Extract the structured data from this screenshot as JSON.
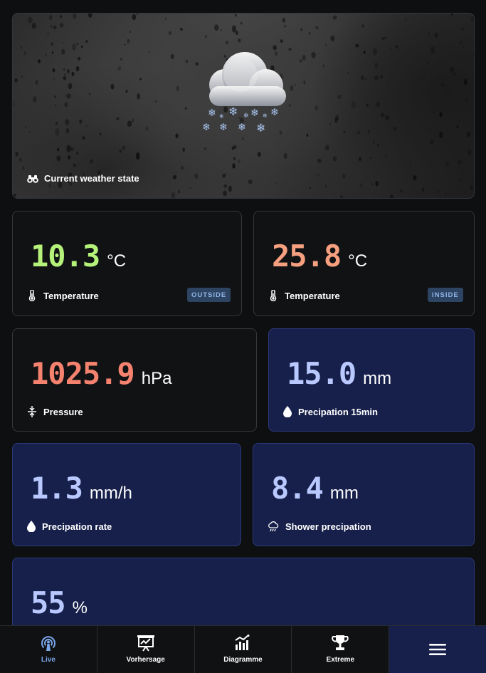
{
  "hero": {
    "label": "Current weather state",
    "state_icon": "snow-cloud-icon"
  },
  "tiles": {
    "temp_outside": {
      "value": "10.3",
      "unit": "°C",
      "label": "Temperature",
      "badge": "OUTSIDE",
      "icon": "thermometer-icon",
      "value_color": "#b5f27a"
    },
    "temp_inside": {
      "value": "25.8",
      "unit": "°C",
      "label": "Temperature",
      "badge": "INSIDE",
      "icon": "thermometer-icon",
      "value_color": "#f6a07f"
    },
    "pressure": {
      "value": "1025.9",
      "unit": "hPa",
      "label": "Pressure",
      "icon": "compress-arrows-icon",
      "value_color": "#f5826f"
    },
    "precip_15min": {
      "value": "15.0",
      "unit": "mm",
      "label": "Precipation 15min",
      "icon": "droplet-icon",
      "value_color": "#b9c9ff"
    },
    "precip_rate": {
      "value": "1.3",
      "unit": "mm/h",
      "label": "Precipation rate",
      "icon": "droplet-icon",
      "value_color": "#b9c9ff"
    },
    "shower_precip": {
      "value": "8.4",
      "unit": "mm",
      "label": "Shower precipation",
      "icon": "cloud-rain-icon",
      "value_color": "#b9c9ff"
    },
    "humidity": {
      "value": "55",
      "unit": "%",
      "value_color": "#b9c9ff"
    }
  },
  "nav": {
    "items": [
      {
        "label": "Live",
        "icon": "broadcast-icon",
        "active": true
      },
      {
        "label": "Vorhersage",
        "icon": "presentation-chart-icon"
      },
      {
        "label": "Diagramme",
        "icon": "bar-chart-icon"
      },
      {
        "label": "Extreme",
        "icon": "trophy-icon"
      }
    ],
    "menu_icon": "hamburger-menu-icon"
  },
  "colors": {
    "accent": "#7aa7ea",
    "card_blue": "#17204b",
    "card_dark": "#111214"
  }
}
